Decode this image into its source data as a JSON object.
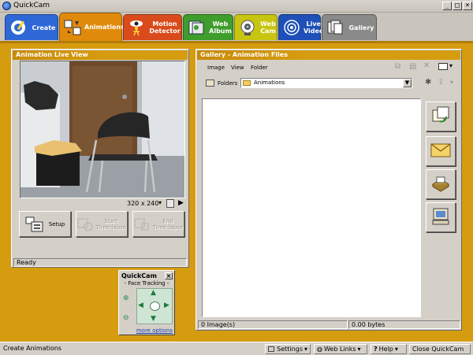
{
  "window": {
    "title": "QuickCam",
    "minimize": "_",
    "maximize": "□",
    "close": "×"
  },
  "tabs": [
    {
      "label": "Create",
      "icon": "create-icon",
      "color": "#2e67d6",
      "active": false
    },
    {
      "label": "Animations",
      "icon": "animations-icon",
      "color": "#e08a0c",
      "active": true
    },
    {
      "label": "Motion\nDetector",
      "icon": "motion-detector-icon",
      "color": "#d94a1c",
      "active": false
    },
    {
      "label": "Web\nAlbum",
      "icon": "web-album-icon",
      "color": "#3f9d2c",
      "active": false
    },
    {
      "label": "Web\nCam",
      "icon": "web-cam-icon",
      "color": "#c8c412",
      "active": false
    },
    {
      "label": "Live\nVideo",
      "icon": "live-video-icon",
      "color": "#1f4fb8",
      "active": false
    },
    {
      "label": "Gallery",
      "icon": "gallery-icon",
      "color": "#8a8a8a",
      "active": false
    }
  ],
  "live_panel": {
    "title": "Animation Live View",
    "resolution": "320 x 240",
    "buttons": [
      {
        "label": "Setup",
        "enabled": true
      },
      {
        "label": "Start\nTime-lapse",
        "enabled": false
      },
      {
        "label": "End\nTime-lapse",
        "enabled": false
      }
    ],
    "status": "Ready"
  },
  "gallery_panel": {
    "title": "Gallery - Animation Files",
    "menu": [
      "Image",
      "View",
      "Folder"
    ],
    "folders_label": "Folders",
    "current_folder": "Animations",
    "image_count": "0 Image(s)",
    "total_size": "0.00 bytes",
    "side_buttons": [
      "convert-icon",
      "email-icon",
      "print-icon",
      "computer-icon"
    ]
  },
  "face_tracking": {
    "title": "QuickCam",
    "subtitle": "- Face Tracking -",
    "more_link": "more options"
  },
  "statusbar": {
    "text": "Create Animations",
    "settings": "Settings",
    "web_links": "Web Links",
    "help": "Help",
    "close": "Close QuickCam"
  },
  "colors": {
    "workspace": "#d59c10",
    "panel_header": "#d59c10",
    "link": "#1f3fa8"
  }
}
